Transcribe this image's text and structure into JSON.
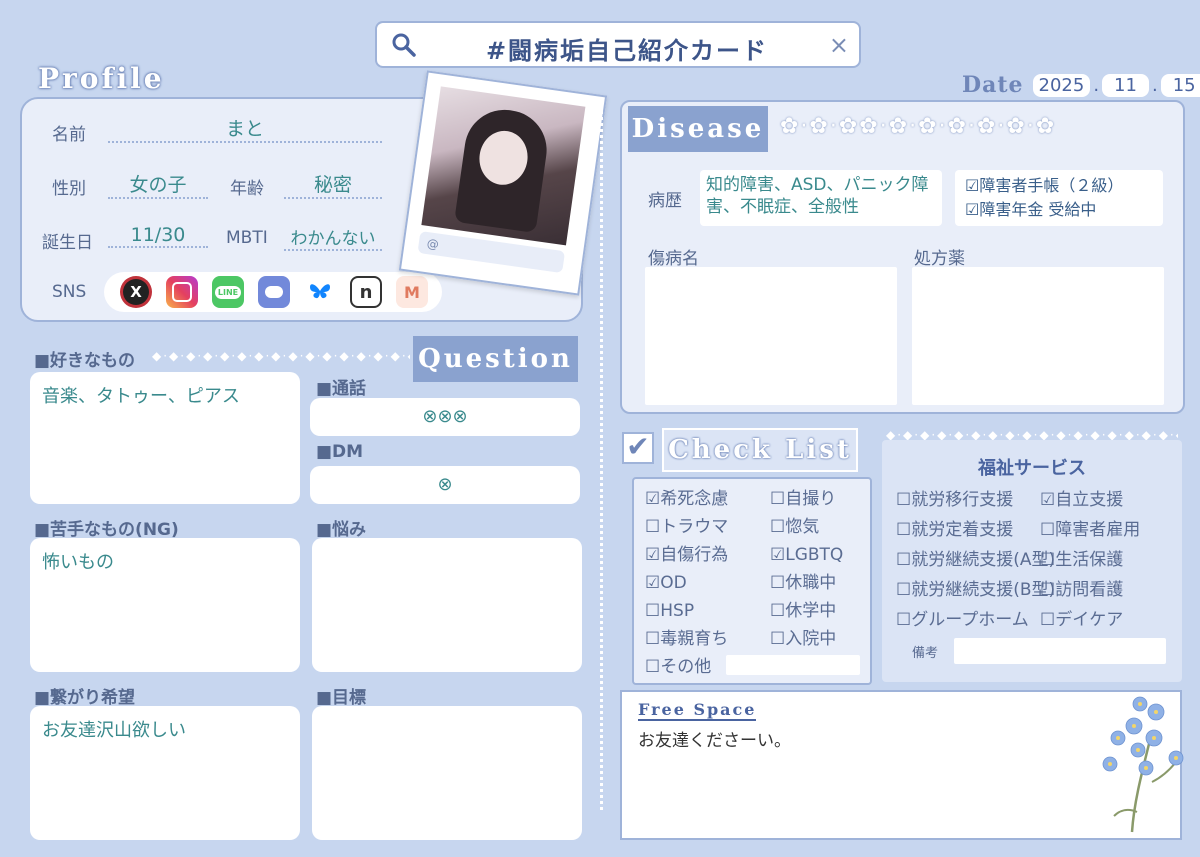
{
  "search": {
    "title": "#闘病垢自己紹介カード",
    "close": "×"
  },
  "date": {
    "label": "Date",
    "year": "2025",
    "month": "11",
    "day": "15",
    "sep": "."
  },
  "profile": {
    "header": "Profile",
    "name_label": "名前",
    "name": "まと",
    "gender_label": "性別",
    "gender": "女の子",
    "age_label": "年齢",
    "age": "秘密",
    "birthday_label": "誕生日",
    "birthday": "11/30",
    "mbti_label": "MBTI",
    "mbti": "わかんない",
    "sns_label": "SNS",
    "sns_icons": [
      "x-icon",
      "instagram-icon",
      "line-icon",
      "discord-icon",
      "bluesky-icon",
      "note-icon",
      "misskey-icon"
    ],
    "photo_at": "@"
  },
  "question": {
    "header": "Question",
    "likes_label": "■好きなもの",
    "likes": "音楽、タトゥー、ピアス",
    "call_label": "■通話",
    "call": "⊗⊗⊗",
    "dm_label": "■DM",
    "dm": "⊗",
    "dislikes_label": "■苦手なもの(NG)",
    "dislikes": "怖いもの",
    "worries_label": "■悩み",
    "worries": "",
    "connect_label": "■繋がり希望",
    "connect": "お友達沢山欲しい",
    "goal_label": "■目標",
    "goal": ""
  },
  "disease": {
    "header": "Disease",
    "history_label": "病歴",
    "history": "知的障害、ASD、パニック障害、不眠症、全般性",
    "cert1": "☑障害者手帳（２級）",
    "cert2": "☑障害年金 受給中",
    "injury_label": "傷病名",
    "prescription_label": "処方薬"
  },
  "checklist": {
    "header": "Check List",
    "col1": [
      "☑希死念慮",
      "☐トラウマ",
      "☑自傷行為",
      "☑OD",
      "☐HSP",
      "☐毒親育ち",
      "☐その他"
    ],
    "col2": [
      "☐自撮り",
      "☐惚気",
      "☑LGBTQ",
      "☐休職中",
      "☐休学中",
      "☐入院中"
    ]
  },
  "welfare": {
    "title": "福祉サービス",
    "col1": [
      "☐就労移行支援",
      "☐就労定着支援",
      "☐就労継続支援(A型)",
      "☐就労継続支援(B型)",
      "☐グループホーム"
    ],
    "col2": [
      "☑自立支援",
      "☐障害者雇用",
      "☐生活保護",
      "☐訪問看護",
      "☐デイケア"
    ],
    "notes_label": "備考"
  },
  "freespace": {
    "label": "Free Space",
    "text": "お友達くださーい。"
  },
  "colors": {
    "background": "#c7d6ef",
    "panel": "#e9eef9",
    "border": "#9fb3d9",
    "accent": "#3a8a8d"
  }
}
